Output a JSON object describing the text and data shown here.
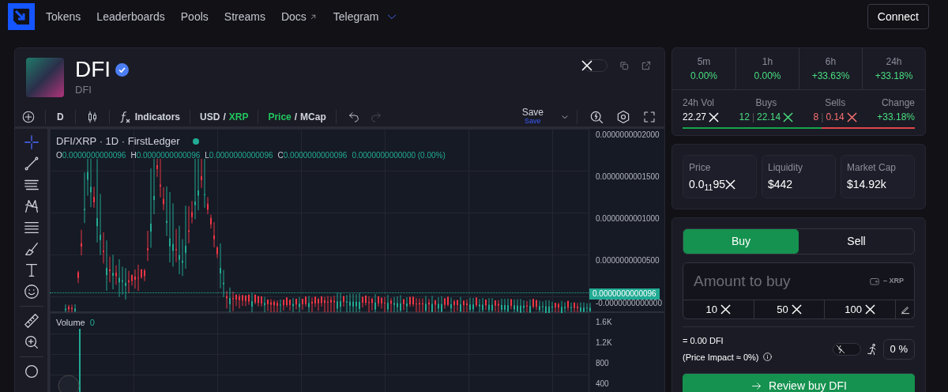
{
  "nav": {
    "links": [
      {
        "label": "Tokens",
        "kind": "link"
      },
      {
        "label": "Leaderboards",
        "kind": "link"
      },
      {
        "label": "Pools",
        "kind": "link"
      },
      {
        "label": "Streams",
        "kind": "link"
      },
      {
        "label": "Docs",
        "kind": "external"
      },
      {
        "label": "Telegram",
        "kind": "dropdown"
      }
    ],
    "connect": "Connect"
  },
  "token": {
    "name": "DFI",
    "symbol": "DFI",
    "verified": true,
    "x_toggle": {
      "on": false
    }
  },
  "toolbar": {
    "interval": "D",
    "indicators": "Indicators",
    "currency": [
      {
        "label": "USD",
        "selected": false
      },
      {
        "label": "XRP",
        "selected": true
      }
    ],
    "mode": [
      {
        "label": "Price",
        "selected": true
      },
      {
        "label": "MCap",
        "selected": false
      }
    ],
    "save": "Save",
    "save_sub": "Save",
    "separator": "/"
  },
  "chart": {
    "legend": "DFI/XRP · 1D · FirstLedger",
    "ohlc": [
      {
        "key": "O",
        "value": "0.0000000000096"
      },
      {
        "key": "H",
        "value": "0.0000000000096"
      },
      {
        "key": "L",
        "value": "0.0000000000096"
      },
      {
        "key": "C",
        "value": "0.0000000000096"
      }
    ],
    "change": "0.0000000000000 (0.00%)",
    "price_ticks": [
      "0.0000000002000",
      "0.0000000001500",
      "0.0000000001000",
      "0.0000000000500"
    ],
    "last_price": "0.0000000000096",
    "zero_tick": "-0.0000000000000",
    "volume_label": "Volume",
    "volume_value": "0",
    "volume_ticks": [
      "1.6K",
      "1.2K",
      "800",
      "400"
    ]
  },
  "periods": [
    {
      "label": "5m",
      "change": "0.00%"
    },
    {
      "label": "1h",
      "change": "0.00%"
    },
    {
      "label": "6h",
      "change": "+33.63%"
    },
    {
      "label": "24h",
      "change": "+33.18%"
    }
  ],
  "trades": {
    "vol_label": "24h Vol",
    "vol": "22.27",
    "buys_label": "Buys",
    "buys_count": "12",
    "buys_amount": "22.14",
    "sells_label": "Sells",
    "sells_count": "8",
    "sells_amount": "0.14",
    "divider": "|",
    "change_label": "Change",
    "change": "+33.18%",
    "buy_share": {
      "level": 0.6
    }
  },
  "metrics": [
    {
      "label": "Price",
      "value": "0.0$_{11}$95",
      "unit": true
    },
    {
      "label": "Liquidity",
      "value": "$442",
      "unit": false
    },
    {
      "label": "Market Cap",
      "value": "$14.92k",
      "unit": false
    }
  ],
  "trade": {
    "tabs": [
      {
        "label": "Buy",
        "selected": true
      },
      {
        "label": "Sell",
        "selected": false
      }
    ],
    "placeholder": "Amount to buy",
    "balance": "– XRP",
    "presets": [
      "10",
      "50",
      "100"
    ],
    "output": "= 0.00 DFI",
    "impact": "(Price Impact ≈ 0%)",
    "mev_toggle": {
      "on": false
    },
    "slippage": "0 %",
    "review": "Review buy DFI"
  }
}
